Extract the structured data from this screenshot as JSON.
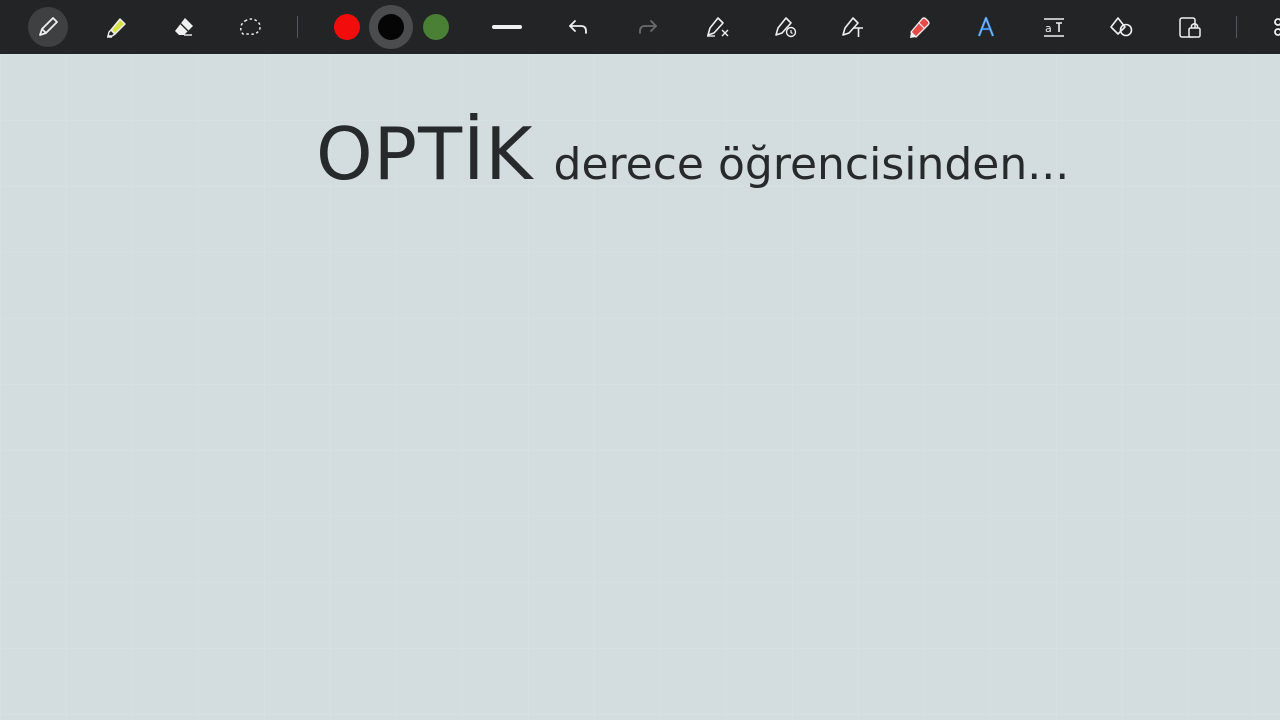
{
  "toolbar": {
    "tools": [
      {
        "name": "pen-tool",
        "icon": "pen-icon",
        "active": true
      },
      {
        "name": "highlighter-tool",
        "icon": "highlighter-icon",
        "active": false
      },
      {
        "name": "eraser-tool",
        "icon": "eraser-icon",
        "active": false
      },
      {
        "name": "lasso-tool",
        "icon": "lasso-icon",
        "active": false
      }
    ],
    "colors": [
      {
        "name": "red",
        "hex": "#f20c0c"
      },
      {
        "name": "black",
        "hex": "#050505",
        "selected": true
      },
      {
        "name": "green",
        "hex": "#4a7f36"
      }
    ],
    "actions": [
      "stroke-width-icon",
      "undo-icon",
      "redo-icon",
      "pen-settings-icon",
      "shape-recognize-icon",
      "text-pen-icon",
      "marker-icon",
      "handwriting-icon",
      "text-box-icon",
      "shapes-icon",
      "lock-icon",
      "more-icon"
    ],
    "accent_color": "#3d8ee6",
    "marker_color": "#e84a4a",
    "highlighter_color": "#d7e24a"
  },
  "canvas": {
    "title_main": "OPTİK",
    "title_sub": "derece öğrencisinden...",
    "background": "#d3dcde",
    "text_color": "#262a2d"
  }
}
